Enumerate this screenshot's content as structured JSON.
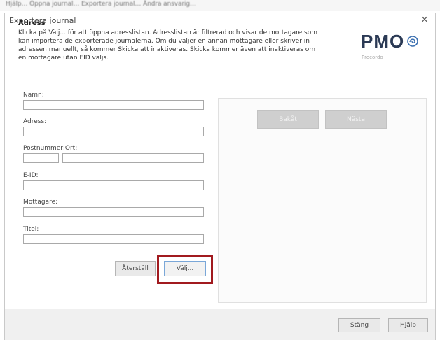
{
  "browser_bar": {
    "crumbs": "Hjälp…   Öppna journal…   Exportera journal…   Ändra ansvarig…"
  },
  "dialog": {
    "title": "Exportera journal",
    "close_glyph": "×"
  },
  "section": {
    "title": "Adress",
    "text": "Klicka på Välj... för att öppna adresslistan. Adresslistan är filtrerad och visar de mottagare som kan importera de exporterade journalerna. Om du väljer en annan mottagare eller skriver in adressen manuellt, så kommer Skicka att inaktiveras. Skicka kommer även att inaktiveras om en mottagare utan EID väljs."
  },
  "logo": {
    "text": "PMO",
    "subtitle": "Procordo",
    "color": "#2b3a55",
    "icon": "pmo-swirl-icon"
  },
  "form": {
    "name_label": "Namn:",
    "name_value": "",
    "address_label": "Adress:",
    "address_value": "",
    "postal_label": "Postnummer:Ort:",
    "postal_value": "",
    "city_value": "",
    "eid_label": "E-ID:",
    "eid_value": "",
    "recipient_label": "Mottagare:",
    "recipient_value": "",
    "title_label": "Titel:",
    "title_value": ""
  },
  "buttons": {
    "reset": "Återställ",
    "choose": "Välj...",
    "back": "Bakåt",
    "next": "Nästa",
    "close": "Stäng",
    "help": "Hjälp"
  },
  "colors": {
    "highlight": "#a11a1f",
    "disabled_button": "#cfcfcf"
  }
}
